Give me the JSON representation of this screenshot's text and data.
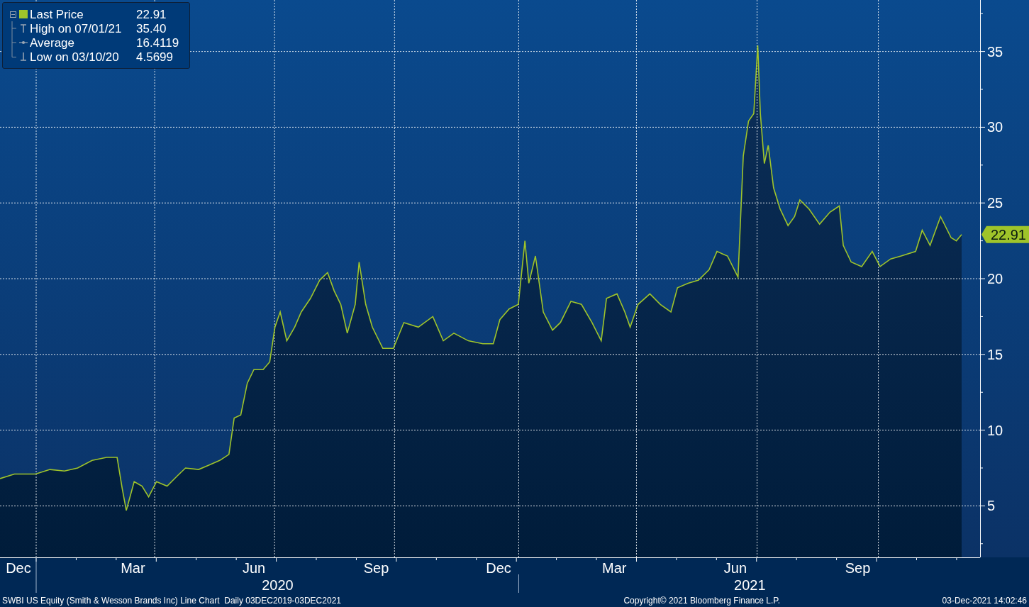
{
  "legend": {
    "items": [
      {
        "kind": "series",
        "label": "Last Price",
        "value": "22.91",
        "color": "#9fc42a"
      },
      {
        "kind": "high",
        "label": "High on 07/01/21",
        "value": "35.40"
      },
      {
        "kind": "average",
        "label": "Average",
        "value": "16.4119"
      },
      {
        "kind": "low",
        "label": "Low on 03/10/20",
        "value": "4.5699"
      }
    ]
  },
  "chart": {
    "chart_data": {
      "type": "area",
      "grid": true,
      "xlim": [
        "2019-12-03",
        "2021-12-17"
      ],
      "ylim": [
        1.6,
        38.4
      ],
      "yticks": [
        5,
        10,
        15,
        20,
        25,
        30,
        35
      ],
      "xticks": [
        {
          "value": "2019-12-17",
          "label": "Dec"
        },
        {
          "value": "2020-03-13",
          "label": "Mar"
        },
        {
          "value": "2020-06-13",
          "label": "Jun"
        },
        {
          "value": "2020-09-14",
          "label": "Sep"
        },
        {
          "value": "2020-12-16",
          "label": "Dec"
        },
        {
          "value": "2021-03-14",
          "label": "Mar"
        },
        {
          "value": "2021-06-14",
          "label": "Jun"
        },
        {
          "value": "2021-09-15",
          "label": "Sep"
        }
      ],
      "x": [
        "2019-12-03",
        "2019-12-14",
        "2019-12-30",
        "2020-01-10",
        "2020-01-21",
        "2020-01-31",
        "2020-02-11",
        "2020-02-22",
        "2020-03-01",
        "2020-03-05",
        "2020-03-08",
        "2020-03-14",
        "2020-03-20",
        "2020-03-25",
        "2020-03-31",
        "2020-04-08",
        "2020-04-16",
        "2020-04-22",
        "2020-05-02",
        "2020-05-10",
        "2020-05-18",
        "2020-05-25",
        "2020-05-29",
        "2020-06-03",
        "2020-06-08",
        "2020-06-13",
        "2020-06-20",
        "2020-06-25",
        "2020-06-29",
        "2020-07-03",
        "2020-07-08",
        "2020-07-14",
        "2020-07-19",
        "2020-07-26",
        "2020-08-02",
        "2020-08-08",
        "2020-08-13",
        "2020-08-18",
        "2020-08-23",
        "2020-08-29",
        "2020-09-01",
        "2020-09-06",
        "2020-09-11",
        "2020-09-19",
        "2020-09-27",
        "2020-10-05",
        "2020-10-16",
        "2020-10-27",
        "2020-11-04",
        "2020-11-12",
        "2020-11-23",
        "2020-12-04",
        "2020-12-12",
        "2020-12-17",
        "2020-12-24",
        "2020-12-31",
        "2021-01-05",
        "2021-01-08",
        "2021-01-13",
        "2021-01-19",
        "2021-01-26",
        "2021-02-01",
        "2021-02-09",
        "2021-02-17",
        "2021-02-25",
        "2021-03-04",
        "2021-03-08",
        "2021-03-16",
        "2021-03-22",
        "2021-03-26",
        "2021-04-01",
        "2021-04-10",
        "2021-04-18",
        "2021-04-26",
        "2021-05-01",
        "2021-05-09",
        "2021-05-17",
        "2021-05-25",
        "2021-05-31",
        "2021-06-08",
        "2021-06-16",
        "2021-06-20",
        "2021-06-24",
        "2021-06-28",
        "2021-07-01",
        "2021-07-03",
        "2021-07-06",
        "2021-07-09",
        "2021-07-13",
        "2021-07-18",
        "2021-07-24",
        "2021-07-29",
        "2021-08-02",
        "2021-08-09",
        "2021-08-17",
        "2021-08-25",
        "2021-09-01",
        "2021-09-04",
        "2021-09-10",
        "2021-09-18",
        "2021-09-26",
        "2021-10-02",
        "2021-10-10",
        "2021-10-18",
        "2021-10-29",
        "2021-11-03",
        "2021-11-09",
        "2021-11-17",
        "2021-11-25",
        "2021-11-29",
        "2021-12-03"
      ],
      "series": [
        {
          "color": "#9fc42a",
          "values": [
            6.8,
            7.1,
            7.1,
            7.4,
            7.3,
            7.5,
            8.0,
            8.2,
            8.2,
            6.1,
            4.7,
            6.6,
            6.3,
            5.6,
            6.6,
            6.3,
            7.0,
            7.5,
            7.4,
            7.7,
            8.0,
            8.4,
            10.8,
            11.0,
            13.1,
            14.0,
            14.0,
            14.5,
            16.8,
            17.8,
            15.9,
            16.8,
            17.8,
            18.7,
            19.9,
            20.4,
            19.2,
            18.3,
            16.4,
            18.3,
            21.1,
            18.3,
            16.8,
            15.4,
            15.4,
            17.1,
            16.8,
            17.5,
            15.9,
            16.4,
            15.9,
            15.7,
            15.7,
            17.3,
            18.0,
            18.3,
            22.5,
            19.7,
            21.5,
            17.8,
            16.6,
            17.1,
            18.5,
            18.3,
            17.1,
            15.9,
            18.7,
            19.0,
            17.8,
            16.8,
            18.3,
            19.0,
            18.3,
            17.8,
            19.4,
            19.7,
            19.9,
            20.6,
            21.8,
            21.5,
            20.1,
            28.1,
            30.4,
            30.9,
            35.4,
            30.9,
            27.6,
            28.8,
            26.0,
            24.6,
            23.5,
            24.1,
            25.2,
            24.6,
            23.6,
            24.4,
            24.8,
            22.2,
            21.1,
            20.8,
            21.8,
            20.8,
            21.3,
            21.5,
            21.8,
            23.2,
            22.2,
            24.1,
            22.7,
            22.5,
            22.91
          ]
        }
      ]
    },
    "years": [
      "2020",
      "2021"
    ],
    "last_price_tag": "22.91"
  },
  "footer": {
    "left": "SWBI US Equity (Smith & Wesson Brands Inc) Line Chart  Daily 03DEC2019-03DEC2021",
    "center": "Copyright© 2021 Bloomberg Finance L.P.",
    "right": "03-Dec-2021 14:02:46"
  }
}
